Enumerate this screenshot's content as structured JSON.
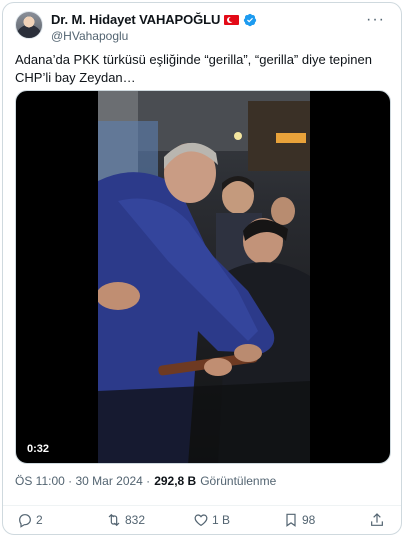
{
  "author": {
    "display_name": "Dr. M. Hidayet VAHAPOĞLU",
    "handle": "@HVahapoglu",
    "verified": true,
    "flag": "Turkey flag"
  },
  "tweet": {
    "text": "Adana’da PKK türküsü eşliğinde “gerilla”, “gerilla” diye tepinen CHP’li bay Zeydan…"
  },
  "media": {
    "type": "video",
    "duration": "0:32"
  },
  "meta": {
    "timestamp": "ÖS 11:00 · 30 Mar 2024 ·",
    "views_count": "292,8 B",
    "views_label": "Görüntülenme"
  },
  "actions": {
    "replies": "2",
    "reposts": "832",
    "likes": "1 B",
    "bookmarks": "98"
  },
  "colors": {
    "text": "#0f1419",
    "muted": "#536471",
    "border": "#cfd9de",
    "verified": "#1d9bf0"
  }
}
